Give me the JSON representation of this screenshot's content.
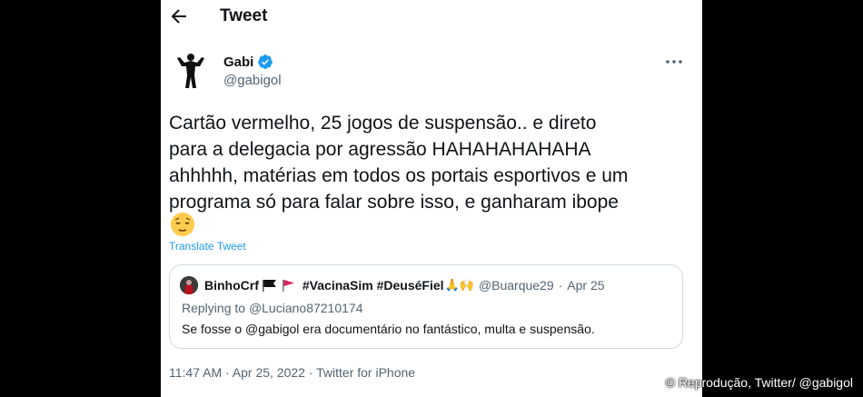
{
  "header": {
    "title": "Tweet",
    "back_icon": "arrow-left-icon"
  },
  "author": {
    "name": "Gabi",
    "handle": "@gabigol",
    "verified_color": "#1d9bf0"
  },
  "tweet": {
    "text": "Cartão vermelho, 25 jogos de suspensão.. e direto\npara a delegacia por agressão HAHAHAHAHAHA\nahhhhh, matérias em todos os portais esportivos e um\nprograma só para falar sobre isso, e ganharam ibope",
    "emoji": "relieved-face-emoji",
    "translate_label": "Translate Tweet"
  },
  "quoted_tweet": {
    "author_name": "BinhoCrf",
    "tags": "#VacinaSim #DeuséFiel",
    "hands_emoji": "🙏🙌",
    "handle": "@Buarque29",
    "dot": "·",
    "date": "Apr 25",
    "replying_label": "Replying to ",
    "replying_to": "@Luciano87210174",
    "text": "Se fosse o @gabigol era documentário no fantástico, multa e suspensão."
  },
  "meta": {
    "timestamp": "11:47 AM · Apr 25, 2022 · Twitter for iPhone"
  },
  "credit": "© Reprodução, Twitter/ @gabigol",
  "colors": {
    "link": "#1d9bf0",
    "secondary": "#536471",
    "text": "#0f1419",
    "border": "#cfd9de"
  }
}
